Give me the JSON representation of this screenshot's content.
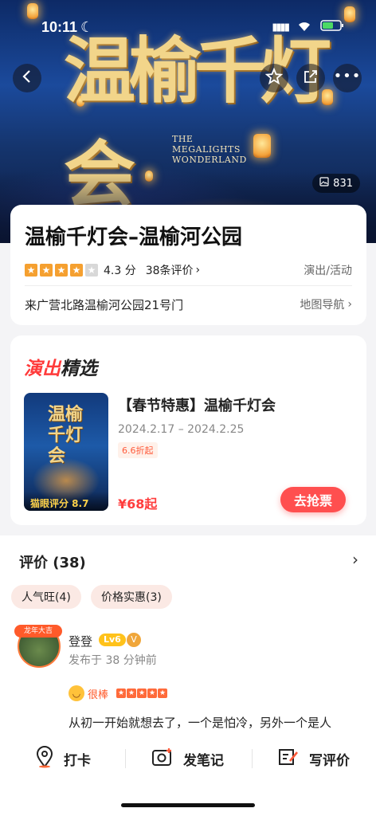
{
  "status": {
    "time": "10:11"
  },
  "hero": {
    "title_art": "温榆千灯会",
    "subtitle_lines": [
      "THE",
      "MEGALIGHTS",
      "WONDERLAND"
    ],
    "photo_count": "831"
  },
  "poi": {
    "name": "温榆千灯会–温榆河公园",
    "rating": {
      "stars": 4,
      "score": "4.3 分",
      "reviews_link": "38条评价"
    },
    "category": "演出/活动",
    "address": "来广营北路温榆河公园21号门",
    "map_nav": "地图导航"
  },
  "shows": {
    "section_title": {
      "part1": "演出",
      "part2": "精选"
    },
    "item": {
      "poster_text": "温榆千灯会",
      "poster_score": "猫眼评分 8.7",
      "name": "【春节特惠】温榆千灯会",
      "date": "2024.2.17 – 2024.2.25",
      "discount": "6.6折起",
      "price": "¥68起",
      "buy_label": "去抢票"
    }
  },
  "reviews": {
    "header": "评价 (38)",
    "chips": [
      "人气旺(4)",
      "价格实惠(3)"
    ],
    "first": {
      "avatar_tag": "龙年大吉",
      "user": "登登",
      "level": "Lv6",
      "verified": "V",
      "time": "发布于 38 分钟前",
      "mood": "很棒",
      "stars": 5,
      "text": "从初一开始就想去了，一个是怕冷，另外一个是人"
    }
  },
  "bottom_bar": {
    "checkin": "打卡",
    "note": "发笔记",
    "review": "写评价"
  },
  "colors": {
    "accent": "#ff4f4f",
    "star": "#f5a030",
    "brand_red": "#ff3d3d"
  }
}
